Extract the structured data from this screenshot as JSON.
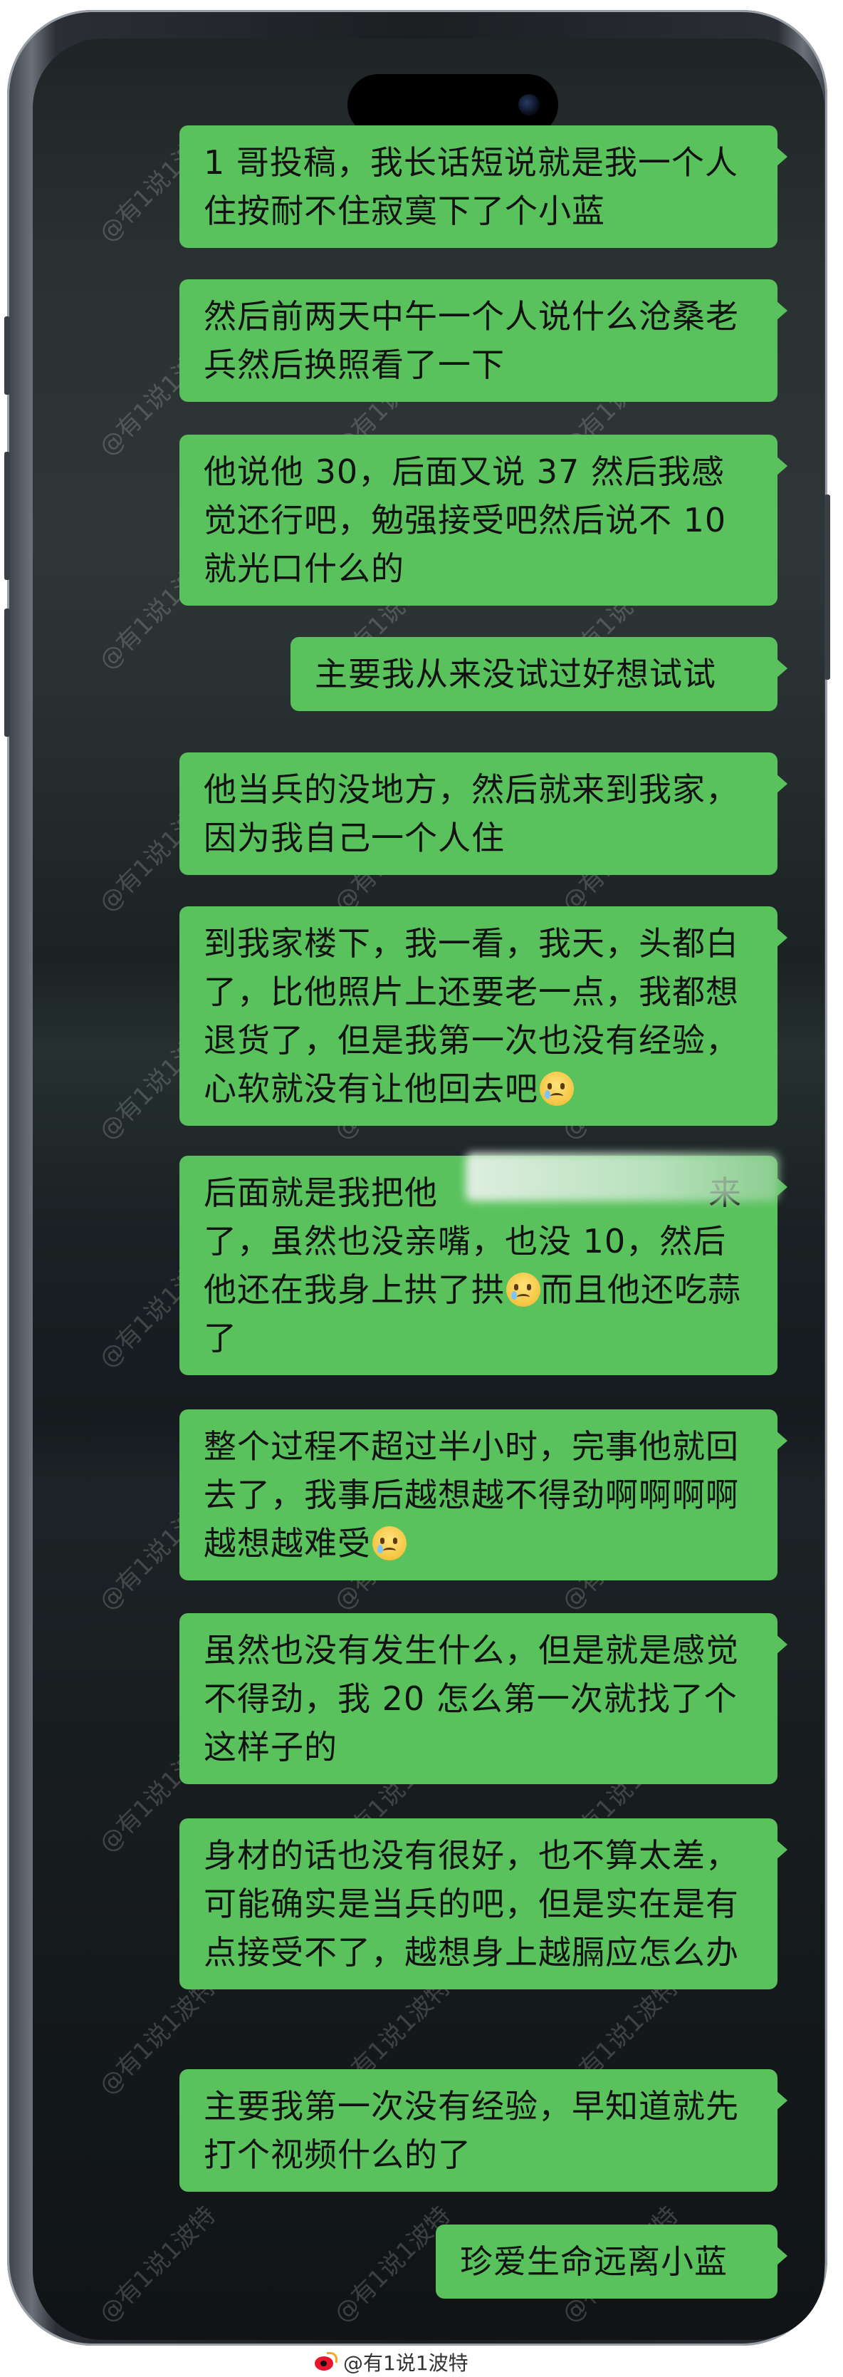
{
  "watermark_text": "@有1说1波特",
  "messages": [
    {
      "text": "1 哥投稿，我长话短说就是我一个人住按耐不住寂寞下了个小蓝"
    },
    {
      "text": "然后前两天中午一个人说什么沧桑老兵然后换照看了一下"
    },
    {
      "text": "他说他 30，后面又说 37 然后我感觉还行吧，勉强接受吧然后说不 10 就光口什么的"
    },
    {
      "text": "主要我从来没试过好想试试"
    },
    {
      "text": "他当兵的没地方，然后就来到我家，因为我自己一个人住"
    },
    {
      "text": "到我家楼下，我一看，我天，头都白了，比他照片上还要老一点，我都想退货了，但是我第一次也没有经验，心软就没有让他回去吧"
    },
    {
      "text_a": "后面就是我把他",
      "text_b": "来了，虽然也没亲嘴，也没 10，然后他还在我身上拱了拱",
      "text_c": "而且他还吃蒜了"
    },
    {
      "text": "整个过程不超过半小时，完事他就回去了，我事后越想越不得劲啊啊啊啊越想越难受"
    },
    {
      "text": "虽然也没有发生什么，但是就是感觉不得劲，我 20 怎么第一次就找了个这样子的"
    },
    {
      "text": "身材的话也没有很好，也不算太差，可能确实是当兵的吧，但是实在是有点接受不了，越想身上越膈应怎么办"
    },
    {
      "text": "主要我第一次没有经验，早知道就先打个视频什么的了"
    },
    {
      "text": "珍爱生命远离小蓝"
    }
  ],
  "footer": {
    "handle": "@有1说1波特"
  },
  "colors": {
    "bubble": "#5ac25d",
    "background": "#1b2224"
  }
}
